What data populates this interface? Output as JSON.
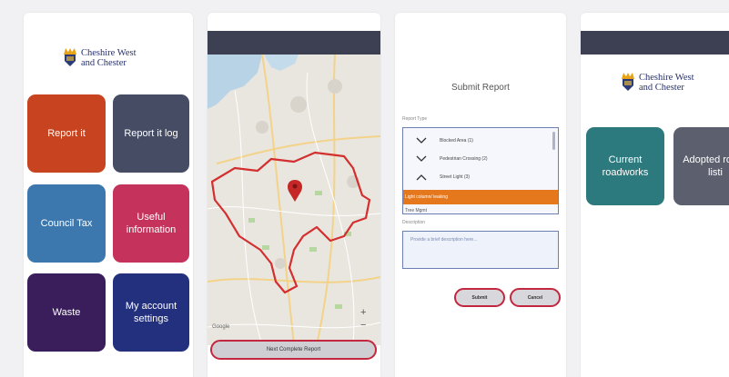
{
  "screen1": {
    "logo_line1": "Cheshire West",
    "logo_line2": "and Chester",
    "tiles": [
      {
        "label": "Report it",
        "color": "#c8431f"
      },
      {
        "label": "Report it log",
        "color": "#454c64"
      },
      {
        "label": "Council Tax",
        "color": "#3c77ae"
      },
      {
        "label": "Useful information",
        "color": "#c5325b"
      },
      {
        "label": "Waste",
        "color": "#3a1e5c"
      },
      {
        "label": "My account settings",
        "color": "#23307e"
      }
    ]
  },
  "screen2": {
    "header_color": "#3d3f52",
    "zoom_in": "+",
    "zoom_out": "−",
    "map_credit": "Google",
    "next_button": "Next Complete Report",
    "boundary_color": "#d32f2f"
  },
  "screen3": {
    "title": "Submit Report",
    "report_type_label": "Report Type",
    "options": [
      {
        "label": "Blocked Area (1)",
        "chevron": "down"
      },
      {
        "label": "Pedestrian Crossing (2)",
        "chevron": "down"
      },
      {
        "label": "Street Light (3)",
        "chevron": "up"
      }
    ],
    "selected_option": "Light column/ leaking",
    "next_option": "Tree Mgmt",
    "description_label": "Description",
    "description_placeholder": "Provide a brief description here...",
    "submit_label": "Submit",
    "cancel_label": "Cancel",
    "accent_color": "#e5781d"
  },
  "screen4": {
    "header_color": "#3d3f52",
    "logo_line1": "Cheshire West",
    "logo_line2": "and Chester",
    "tiles": [
      {
        "label": "Current roadworks",
        "color": "#2c7a7e"
      },
      {
        "label": "Adopted roads listi",
        "color": "#5b5f6e"
      }
    ]
  }
}
